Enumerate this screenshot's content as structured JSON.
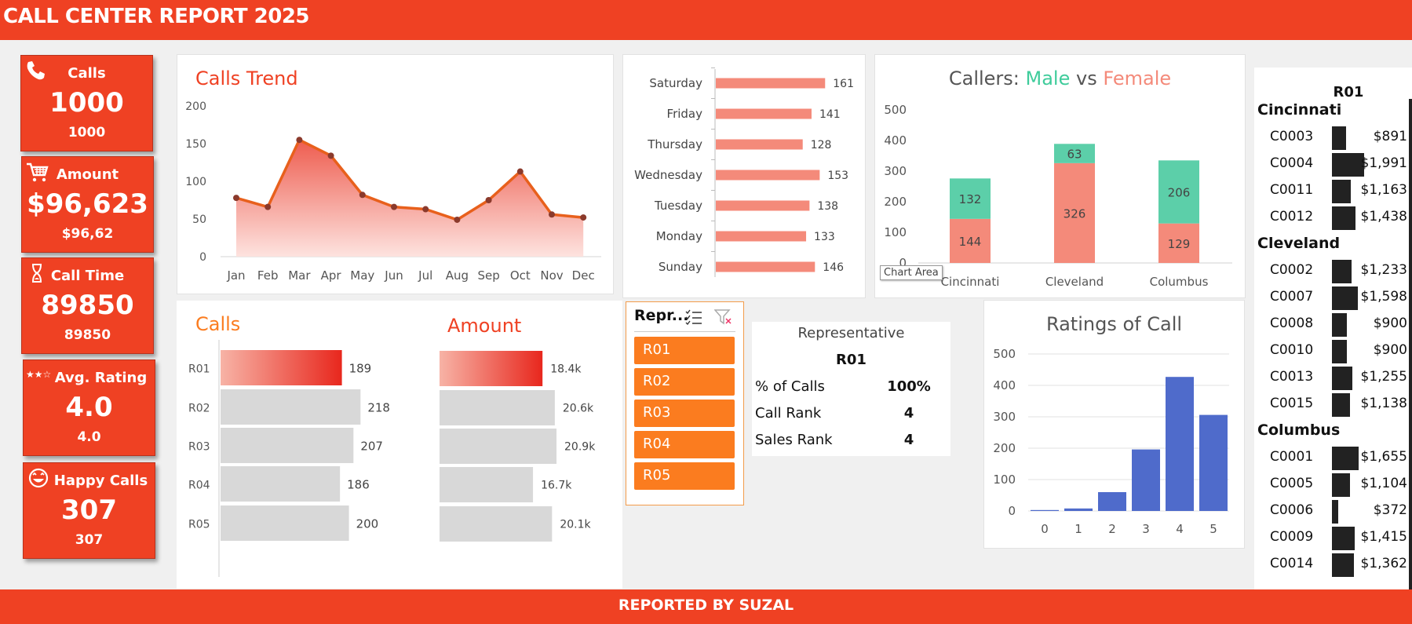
{
  "header": {
    "title": "CALL CENTER REPORT 2025"
  },
  "footer": {
    "text": "REPORTED BY SUZAL"
  },
  "kpis": [
    {
      "label": "Calls",
      "value": "1000",
      "sub": "1000",
      "icon": "phone-icon"
    },
    {
      "label": "Amount",
      "value": "$96,623",
      "sub": "$96,62",
      "icon": "cart-icon"
    },
    {
      "label": "Call Time",
      "value": "89850",
      "sub": "89850",
      "icon": "hourglass-icon"
    },
    {
      "label": "Avg. Rating",
      "value": "4.0",
      "sub": "4.0",
      "icon": "stars-icon",
      "icon_text": "★★☆"
    },
    {
      "label": "Happy Calls",
      "value": "307",
      "sub": "307",
      "icon": "smile-icon"
    }
  ],
  "trend": {
    "title": "Calls Trend",
    "chart_data": {
      "type": "area",
      "categories": [
        "Jan",
        "Feb",
        "Mar",
        "Apr",
        "May",
        "Jun",
        "Jul",
        "Aug",
        "Sep",
        "Oct",
        "Nov",
        "Dec"
      ],
      "values": [
        78,
        66,
        155,
        134,
        82,
        66,
        63,
        49,
        75,
        113,
        56,
        52
      ],
      "yticks": [
        0,
        50,
        100,
        150,
        200
      ],
      "ylim": [
        0,
        200
      ],
      "color": "#e8601c"
    }
  },
  "weekday": {
    "chart_data": {
      "type": "bar",
      "categories": [
        "Saturday",
        "Friday",
        "Thursday",
        "Wednesday",
        "Tuesday",
        "Monday",
        "Sunday"
      ],
      "values": [
        161,
        141,
        128,
        153,
        138,
        133,
        146
      ],
      "color": "#f48a7a"
    }
  },
  "gender": {
    "title_prefix": "Callers: ",
    "title_male": "Male",
    "title_vs": " vs ",
    "title_female": "Female",
    "tooltip": "Chart Area",
    "chart_data": {
      "type": "bar",
      "stacked": true,
      "categories": [
        "Cincinnati",
        "Cleveland",
        "Columbus"
      ],
      "series": [
        {
          "name": "Female",
          "values": [
            144,
            326,
            129
          ],
          "color": "#f48a7a"
        },
        {
          "name": "Male",
          "values": [
            132,
            63,
            206
          ],
          "color": "#5ccfa9"
        }
      ],
      "yticks": [
        0,
        100,
        200,
        300,
        400,
        500
      ],
      "ylim": [
        0,
        500
      ]
    }
  },
  "rep_calls": {
    "title": "Calls",
    "chart_data": {
      "type": "bar",
      "categories": [
        "R01",
        "R02",
        "R03",
        "R04",
        "R05"
      ],
      "values": [
        189,
        218,
        207,
        186,
        200
      ],
      "value_labels": [
        "189",
        "218",
        "207",
        "186",
        "200"
      ],
      "highlight": "R01"
    }
  },
  "rep_amount": {
    "title": "Amount",
    "chart_data": {
      "type": "bar",
      "categories": [
        "R01",
        "R02",
        "R03",
        "R04",
        "R05"
      ],
      "values": [
        18.4,
        20.6,
        20.9,
        16.7,
        20.1
      ],
      "value_labels": [
        "18.4k",
        "20.6k",
        "20.9k",
        "16.7k",
        "20.1k"
      ],
      "highlight": "R01"
    }
  },
  "slicer": {
    "title": "Repr...",
    "items": [
      "R01",
      "R02",
      "R03",
      "R04",
      "R05"
    ]
  },
  "rep_card": {
    "title": "Representative",
    "rep": "R01",
    "rows": [
      {
        "label": "% of Calls",
        "value": "100%"
      },
      {
        "label": "Call Rank",
        "value": "4"
      },
      {
        "label": "Sales Rank",
        "value": "4"
      }
    ]
  },
  "ratings": {
    "title": "Ratings of Call",
    "chart_data": {
      "type": "bar",
      "categories": [
        "0",
        "1",
        "2",
        "3",
        "4",
        "5"
      ],
      "values": [
        3,
        8,
        60,
        196,
        427,
        306
      ],
      "yticks": [
        0,
        100,
        200,
        300,
        400,
        500
      ],
      "ylim": [
        0,
        500
      ],
      "color": "#4f6bcb"
    }
  },
  "rep_table": {
    "header": "R01",
    "groups": [
      {
        "region": "Cincinnati",
        "rows": [
          {
            "code": "C0003",
            "amount": "$891",
            "value": 891
          },
          {
            "code": "C0004",
            "amount": "$1,991",
            "value": 1991
          },
          {
            "code": "C0011",
            "amount": "$1,163",
            "value": 1163
          },
          {
            "code": "C0012",
            "amount": "$1,438",
            "value": 1438
          }
        ]
      },
      {
        "region": "Cleveland",
        "rows": [
          {
            "code": "C0002",
            "amount": "$1,233",
            "value": 1233
          },
          {
            "code": "C0007",
            "amount": "$1,598",
            "value": 1598
          },
          {
            "code": "C0008",
            "amount": "$900",
            "value": 900
          },
          {
            "code": "C0010",
            "amount": "$900",
            "value": 900
          },
          {
            "code": "C0013",
            "amount": "$1,255",
            "value": 1255
          },
          {
            "code": "C0015",
            "amount": "$1,138",
            "value": 1138
          }
        ]
      },
      {
        "region": "Columbus",
        "rows": [
          {
            "code": "C0001",
            "amount": "$1,655",
            "value": 1655
          },
          {
            "code": "C0005",
            "amount": "$1,104",
            "value": 1104
          },
          {
            "code": "C0006",
            "amount": "$372",
            "value": 372
          },
          {
            "code": "C0009",
            "amount": "$1,415",
            "value": 1415
          },
          {
            "code": "C0014",
            "amount": "$1,362",
            "value": 1362
          }
        ]
      }
    ]
  }
}
